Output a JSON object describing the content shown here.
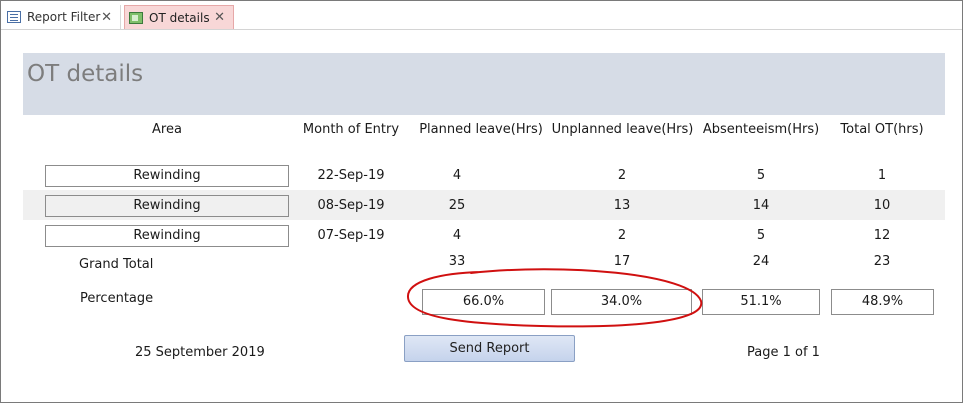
{
  "tabs": [
    {
      "label": "Report Filter",
      "active": false,
      "icon": "form-icon"
    },
    {
      "label": "OT details",
      "active": true,
      "icon": "report-icon"
    }
  ],
  "report": {
    "title": "OT details",
    "headers": [
      "Area",
      "Month of Entry",
      "Planned leave(Hrs)",
      "Unplanned leave(Hrs)",
      "Absenteeism(Hrs)",
      "Total OT(hrs)"
    ],
    "rows": [
      {
        "area": "Rewinding",
        "month": "22-Sep-19",
        "planned": "4",
        "unplanned": "2",
        "absenteeism": "5",
        "total_ot": "1"
      },
      {
        "area": "Rewinding",
        "month": "08-Sep-19",
        "planned": "25",
        "unplanned": "13",
        "absenteeism": "14",
        "total_ot": "10"
      },
      {
        "area": "Rewinding",
        "month": "07-Sep-19",
        "planned": "4",
        "unplanned": "2",
        "absenteeism": "5",
        "total_ot": "12"
      }
    ],
    "grand_total": {
      "label": "Grand Total",
      "planned": "33",
      "unplanned": "17",
      "absenteeism": "24",
      "total_ot": "23"
    },
    "percentage": {
      "label": "Percentage",
      "planned": "66.0%",
      "unplanned": "34.0%",
      "absenteeism": "51.1%",
      "total_ot": "48.9%"
    },
    "date": "25 September 2019",
    "send_button": "Send Report",
    "page_info": "Page 1 of 1"
  },
  "colors": {
    "active_tab": "#f8d7d7",
    "title_band": "#d6dce6",
    "annotation": "#d01010"
  }
}
